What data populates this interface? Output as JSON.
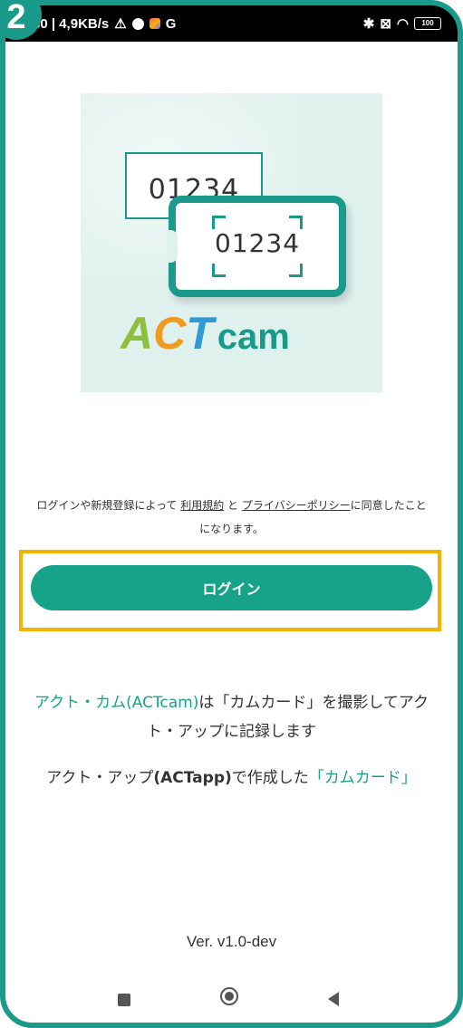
{
  "step_badge": "2",
  "status_bar": {
    "time_speed": "30 | 4,9KB/s",
    "g_label": "G",
    "battery": "100"
  },
  "logo": {
    "back_card_number": "01234",
    "front_card_number": "01234",
    "brand_a": "A",
    "brand_c": "C",
    "brand_t": "T",
    "brand_cam": "cam",
    "colors": {
      "a": "#8dbf3f",
      "c": "#f29a1f",
      "t": "#2f9ad6",
      "cam": "#1a9a8b"
    }
  },
  "terms": {
    "prefix": "ログインや新規登録によって",
    "terms_link": "利用規約",
    "and": "と",
    "privacy_link": "プライバシーポリシー",
    "suffix": "に同意したことになります。"
  },
  "login_button": "ログイン",
  "description": {
    "line1_app": "アクト・カム(ACTcam)",
    "line1_mid": "は「カムカード」を撮影してアクト・アップに記録します",
    "line2_prefix": "アクト・アップ",
    "line2_app": "(ACTapp)",
    "line2_mid": "で作成した",
    "line2_card": "「カムカード」"
  },
  "version": "Ver. v1.0-dev",
  "colors": {
    "accent": "#16a38a",
    "frame": "#1a9a8b",
    "highlight": "#f2b400"
  }
}
